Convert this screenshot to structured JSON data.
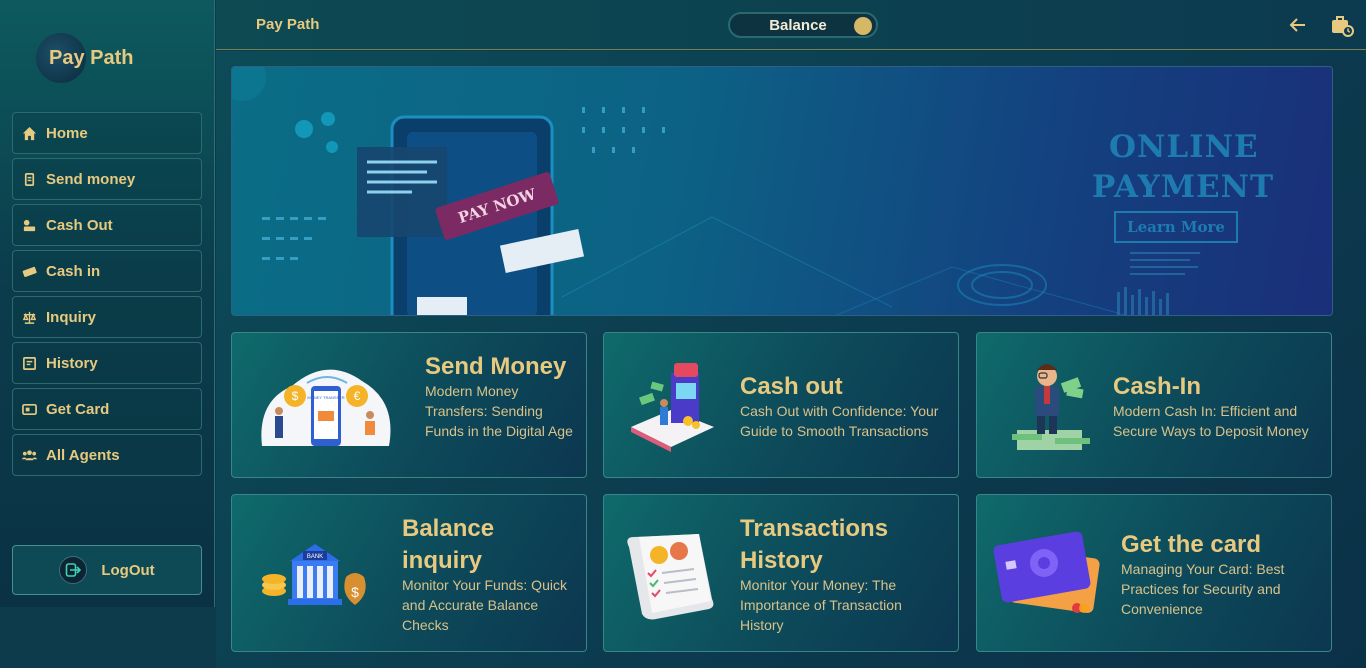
{
  "brand": {
    "name": "Pay Path"
  },
  "nav": [
    {
      "label": "Home",
      "icon": "home-icon"
    },
    {
      "label": "Send money",
      "icon": "money-send-icon"
    },
    {
      "label": "Cash Out",
      "icon": "cash-out-icon"
    },
    {
      "label": "Cash in",
      "icon": "cash-in-icon"
    },
    {
      "label": "Inquiry",
      "icon": "scale-icon"
    },
    {
      "label": "History",
      "icon": "history-icon"
    },
    {
      "label": "Get Card",
      "icon": "card-icon"
    },
    {
      "label": "All Agents",
      "icon": "users-icon"
    }
  ],
  "logout": {
    "label": "LogOut",
    "icon": "logout-icon"
  },
  "topbar": {
    "title": "Pay Path",
    "balance_label": "Balance",
    "back_icon": "arrow-left-icon",
    "bag_icon": "briefcase-clock-icon"
  },
  "banner": {
    "pay_now": "PAY NOW",
    "line1": "ONLINE",
    "line2": "PAYMENT",
    "button": "Learn More"
  },
  "cards": [
    {
      "title": "Send Money",
      "desc": "Modern Money Transfers: Sending Funds in the Digital Age",
      "art_label": "MONEY TRANSFER"
    },
    {
      "title": "Cash out",
      "desc": "Cash Out with Confidence: Your Guide to Smooth Transactions"
    },
    {
      "title": "Cash-In",
      "desc": "Modern Cash In: Efficient and Secure Ways to Deposit Money"
    },
    {
      "title": "Balance inquiry",
      "desc": "Monitor Your Funds: Quick and Accurate Balance Checks",
      "art_label": "BANK"
    },
    {
      "title": "Transactions History",
      "desc": "Monitor Your Money: The Importance of Transaction History"
    },
    {
      "title": "Get the card",
      "desc": "Managing Your Card: Best Practices for Security and Convenience"
    }
  ],
  "colors": {
    "accent": "#e7c97f",
    "sidebar": "#0b3d4c",
    "border": "#3a8587"
  }
}
